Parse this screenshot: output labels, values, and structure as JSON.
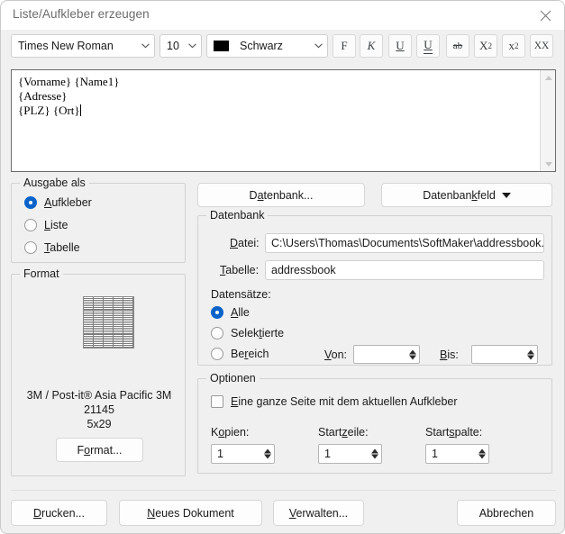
{
  "window": {
    "title": "Liste/Aufkleber erzeugen",
    "close_icon": "close-icon"
  },
  "toolbar": {
    "font_family": "Times New Roman",
    "font_size": "10",
    "color_name": "Schwarz",
    "color_hex": "#000000",
    "buttons": [
      {
        "name": "bold-button",
        "label": "F"
      },
      {
        "name": "italic-button",
        "label": "K"
      },
      {
        "name": "underline-button",
        "label": "U"
      },
      {
        "name": "double-underline-button",
        "label": "U"
      },
      {
        "name": "strikethrough-button",
        "label": "ab"
      },
      {
        "name": "subscript-button",
        "label": "X",
        "affix": "2"
      },
      {
        "name": "superscript-button",
        "label": "x",
        "affix": "2"
      },
      {
        "name": "allcaps-button",
        "label": "XX"
      }
    ]
  },
  "editor": {
    "line1": "{Vorname} {Name1}",
    "line2": "{Adresse}",
    "line3": "{PLZ} {Ort}"
  },
  "ausgabe": {
    "legend": "Ausgabe als",
    "options": [
      {
        "label": "Aufkleber",
        "acc": "A",
        "rest": "ufkleber",
        "selected": true
      },
      {
        "label": "Liste",
        "acc": "L",
        "rest": "iste",
        "selected": false
      },
      {
        "label": "Tabelle",
        "acc": "T",
        "rest": "abelle",
        "selected": false
      }
    ]
  },
  "format": {
    "legend": "Format",
    "preview_cols": 5,
    "preview_rows": 29,
    "caption_line1": "3M / Post-it®  Asia Pacific 3M",
    "caption_line2": "21145",
    "caption_line3": "5x29",
    "button_acc": "F",
    "button_acc_letter": "o",
    "button_rest": "rmat...",
    "button_label": "Format..."
  },
  "database": {
    "btn_datenbank_pre": "D",
    "btn_datenbank_acc": "a",
    "btn_datenbank_rest": "tenbank...",
    "btn_datenbank_label": "Datenbank...",
    "btn_datenbankfeld_pre": "Datenban",
    "btn_datenbankfeld_acc": "k",
    "btn_datenbankfeld_rest": "feld",
    "btn_datenbankfeld_label": "Datenbankfeld",
    "legend": "Datenbank",
    "datei_label_pre": "",
    "datei_label_acc": "D",
    "datei_label_rest": "atei:",
    "datei_value": "C:\\Users\\Thomas\\Documents\\SoftMaker\\addressbook.sq",
    "tabelle_label_acc": "T",
    "tabelle_label_rest": "abelle:",
    "tabelle_value": "addressbook",
    "datensaetze_label": "Datensätze:",
    "record_options": [
      {
        "pre": "",
        "acc": "A",
        "rest": "lle",
        "label": "Alle",
        "selected": true
      },
      {
        "pre": "Selek",
        "acc": "t",
        "rest": "ierte",
        "label": "Selektierte",
        "selected": false
      },
      {
        "pre": "Be",
        "acc": "r",
        "rest": "eich",
        "label": "Bereich",
        "selected": false
      }
    ],
    "von_acc": "V",
    "von_rest": "on:",
    "von_value": "",
    "bis_acc": "B",
    "bis_rest": "is:",
    "bis_value": ""
  },
  "optionen": {
    "legend": "Optionen",
    "checkbox_acc": "E",
    "checkbox_rest": "ine ganze Seite mit dem aktuellen Aufkleber",
    "checkbox_label": "Eine ganze Seite mit dem aktuellen Aufkleber",
    "checkbox_checked": false,
    "kopien_pre": "K",
    "kopien_acc": "o",
    "kopien_rest": "pien:",
    "kopien_value": "1",
    "startzeile_pre": "Start",
    "startzeile_acc": "z",
    "startzeile_rest": "eile:",
    "startzeile_value": "1",
    "startspalte_pre": "Start",
    "startspalte_acc": "s",
    "startspalte_rest": "palte:",
    "startspalte_value": "1"
  },
  "footer": {
    "drucken_acc": "D",
    "drucken_rest": "rucken...",
    "drucken_label": "Drucken...",
    "neuesdok_acc": "N",
    "neuesdok_rest": "eues Dokument",
    "neuesdok_label": "Neues Dokument",
    "verwalten_acc": "V",
    "verwalten_rest": "erwalten...",
    "verwalten_label": "Verwalten...",
    "abbrechen_label": "Abbrechen"
  }
}
